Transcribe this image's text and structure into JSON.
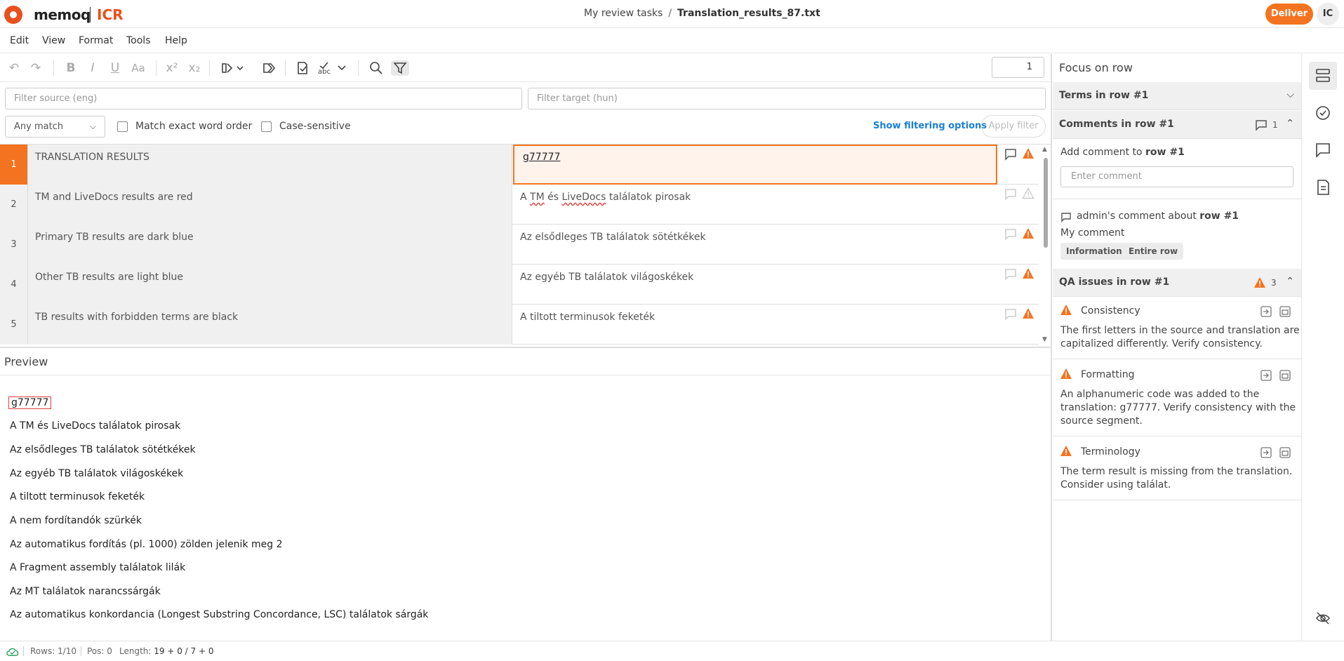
{
  "header": {
    "logo_text": "memoq",
    "product": "ICR",
    "breadcrumb_parent": "My review tasks",
    "breadcrumb_sep": "/",
    "breadcrumb_current": "Translation_results_87.txt",
    "deliver_label": "Deliver",
    "avatar_initials": "IC"
  },
  "menu": [
    "Edit",
    "View",
    "Format",
    "Tools",
    "Help"
  ],
  "toolbar": {
    "row_number": "1"
  },
  "filters": {
    "source_placeholder": "Filter source (eng)",
    "target_placeholder": "Filter target (hun)",
    "match_mode": "Any match",
    "exact_word_order_label": "Match exact word order",
    "case_sensitive_label": "Case-sensitive",
    "show_options_label": "Show filtering options",
    "apply_label": "Apply filter"
  },
  "grid": {
    "rows": [
      {
        "num": "1",
        "source": "TRANSLATION RESULTS",
        "target": "g77777"
      },
      {
        "num": "2",
        "source": "TM and LiveDocs results are red",
        "target_pre": "A ",
        "target_t1": "TM",
        "target_mid": " és ",
        "target_t2": "LiveDocs",
        "target_post": " találatok pirosak"
      },
      {
        "num": "3",
        "source": "Primary TB results are dark blue",
        "target": "Az elsődleges TB találatok sötétkékek"
      },
      {
        "num": "4",
        "source": "Other TB results are light blue",
        "target": "Az egyéb TB találatok világoskékek"
      },
      {
        "num": "5",
        "source": "TB results with forbidden terms are black",
        "target": "A tiltott terminusok feketék"
      }
    ]
  },
  "preview": {
    "title": "Preview",
    "lines": [
      "g77777",
      "A TM és LiveDocs találatok pirosak",
      "Az elsődleges TB találatok sötétkékek",
      "Az egyéb TB találatok világoskékek",
      "A tiltott terminusok feketék",
      "A nem fordítandók szürkék",
      "Az automatikus fordítás (pl. 1000) zölden jelenik meg 2",
      "A Fragment assembly találatok lilák",
      "Az MT találatok narancssárgák",
      "Az automatikus konkordancia (Longest Substring Concordance, LSC) találatok sárgák"
    ]
  },
  "focus_panel": {
    "title": "Focus on row",
    "terms_label": "Terms in row #1",
    "comments_label": "Comments in row #1",
    "comments_count": "1",
    "add_comment_prefix": "Add comment to ",
    "add_comment_row": "row #1",
    "comment_placeholder": "Enter comment",
    "comment_author_prefix": "admin's comment about ",
    "comment_author_row": "row #1",
    "comment_text": "My comment",
    "comment_tags": [
      "Information",
      "Entire row"
    ],
    "qa_label": "QA issues in row #1",
    "qa_count": "3",
    "qa_issues": [
      {
        "title": "Consistency",
        "line1": "The first letters in the source and translation are",
        "line2": "capitalized differently. Verify consistency.",
        "line3": ""
      },
      {
        "title": "Formatting",
        "line1": "An alphanumeric code was added to the",
        "line2": "translation: g77777. Verify consistency with the",
        "line3": "source segment."
      },
      {
        "title": "Terminology",
        "line1": "The term result is missing from the translation.",
        "line2": "Consider using találat.",
        "line3": ""
      }
    ]
  },
  "statusbar": {
    "rows": "Rows: 1/10",
    "pos": "Pos: 0",
    "length_label": "Length: ",
    "length_value": "19 + 0 / 7 + 0"
  },
  "colors": {
    "accent": "#f47320",
    "brand": "#e8501e",
    "link": "#1a7fd4"
  }
}
